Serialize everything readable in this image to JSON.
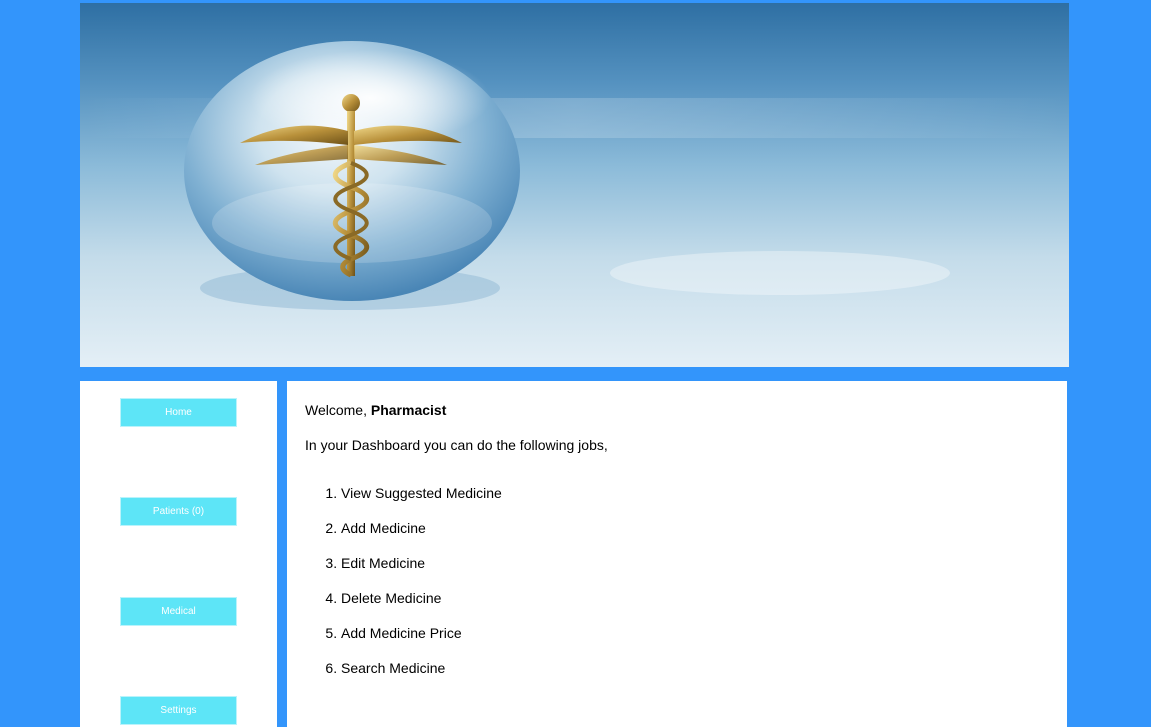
{
  "sidebar": {
    "items": [
      {
        "label": "Home"
      },
      {
        "label": "Patients (0)"
      },
      {
        "label": "Medical"
      },
      {
        "label": "Settings"
      }
    ]
  },
  "main": {
    "welcome_prefix": "Welcome, ",
    "user_role": "Pharmacist",
    "intro": "In your Dashboard you can do the following jobs,",
    "jobs": [
      "View Suggested Medicine",
      "Add Medicine",
      "Edit Medicine",
      "Delete Medicine",
      "Add Medicine Price",
      "Search Medicine"
    ]
  },
  "colors": {
    "page_background": "#3395fb",
    "nav_button": "#5de5f7",
    "panel": "#ffffff"
  },
  "banner": {
    "image": "caduceus-crystal-sphere"
  }
}
